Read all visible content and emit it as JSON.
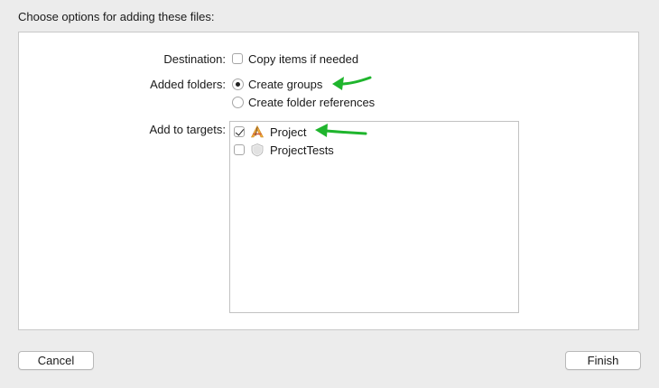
{
  "dialog": {
    "title": "Choose options for adding these files:"
  },
  "destination": {
    "label": "Destination:",
    "copy_items": {
      "label": "Copy items if needed",
      "checked": false
    }
  },
  "added_folders": {
    "label": "Added folders:",
    "options": [
      {
        "label": "Create groups",
        "selected": true
      },
      {
        "label": "Create folder references",
        "selected": false
      }
    ]
  },
  "targets": {
    "label": "Add to targets:",
    "items": [
      {
        "name": "Project",
        "checked": true,
        "icon": "app-target-icon"
      },
      {
        "name": "ProjectTests",
        "checked": false,
        "icon": "test-bundle-icon"
      }
    ]
  },
  "buttons": {
    "cancel": "Cancel",
    "finish": "Finish"
  },
  "annotation": {
    "arrow_color": "#1fb52d"
  }
}
